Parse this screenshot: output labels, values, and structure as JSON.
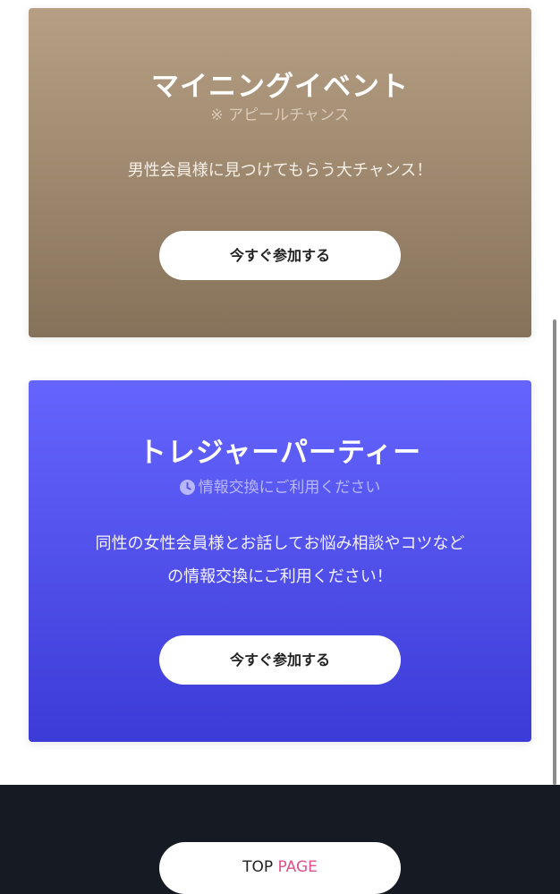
{
  "mining_card": {
    "title": "マイニングイベント",
    "subtitle": "※ アピールチャンス",
    "description": "男性会員様に見つけてもらう大チャンス！",
    "button_label": "今すぐ参加する"
  },
  "treasure_card": {
    "title": "トレジャーパーティー",
    "subtitle": "情報交換にご利用ください",
    "subtitle_icon": "clock-icon",
    "description_line1": "同性の女性会員様とお話してお悩み相談やコツなど",
    "description_line2": "の情報交換にご利用ください！",
    "button_label": "今すぐ参加する"
  },
  "footer": {
    "top_label_part1": "TOP",
    "top_label_part2": "PAGE"
  },
  "colors": {
    "mining_gradient_top": "#b69f84",
    "mining_gradient_bottom": "#86725a",
    "treasure_gradient_top": "#6565fe",
    "treasure_gradient_bottom": "#3c3bd7",
    "footer_bg": "#161a23",
    "accent_pink": "#e0508a"
  }
}
